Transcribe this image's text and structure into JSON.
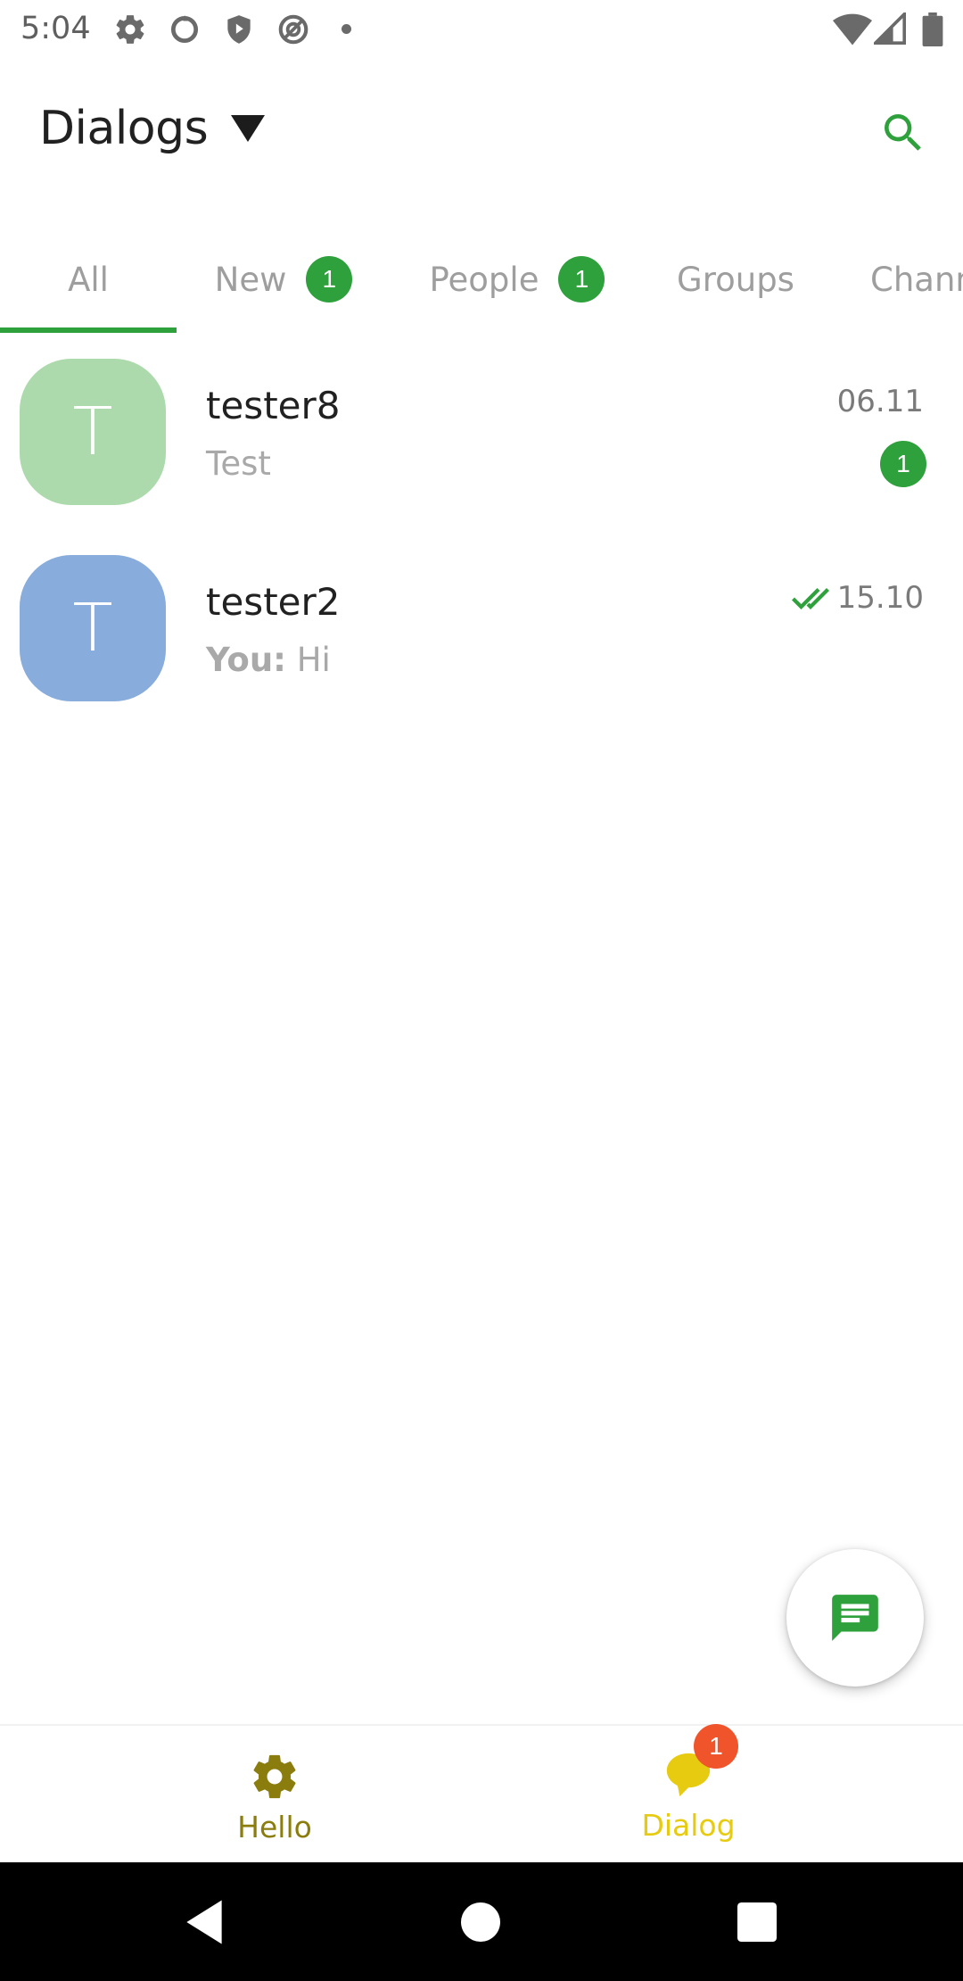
{
  "status_bar": {
    "time": "5:04",
    "icons": [
      "gear-icon",
      "circle-icon",
      "shield-icon",
      "sync-icon",
      "dot-icon"
    ],
    "right_icons": [
      "wifi-icon",
      "signal-icon",
      "battery-icon"
    ]
  },
  "header": {
    "title": "Dialogs",
    "search_icon": "search-icon",
    "dropdown_icon": "triangle-down-icon"
  },
  "tabs": [
    {
      "label": "All",
      "badge": ""
    },
    {
      "label": "New",
      "badge": "1"
    },
    {
      "label": "People",
      "badge": "1"
    },
    {
      "label": "Groups",
      "badge": ""
    },
    {
      "label": "Channels",
      "badge": ""
    }
  ],
  "dialogs": [
    {
      "avatar_letter": "T",
      "avatar_color": "#acdaac",
      "name": "tester8",
      "preview_prefix": "",
      "preview": "Test",
      "date": "06.11",
      "unread": "1",
      "read_receipt": false
    },
    {
      "avatar_letter": "T",
      "avatar_color": "#88acdc",
      "name": "tester2",
      "preview_prefix": "You:",
      "preview": "Hi",
      "date": "15.10",
      "unread": "",
      "read_receipt": true
    }
  ],
  "fab": {
    "icon": "message-icon"
  },
  "bottom_nav": {
    "items": [
      {
        "label": "Hello",
        "icon": "gear-icon",
        "color": "#8a7d0e"
      },
      {
        "label": "Dialog",
        "icon": "chat-bubble-icon",
        "color": "#e7cb10"
      }
    ],
    "dialog_badge": "1"
  },
  "colors": {
    "accent": "#2ea03c",
    "badge_red": "#f0542b",
    "text_muted": "#9e9e9e"
  }
}
